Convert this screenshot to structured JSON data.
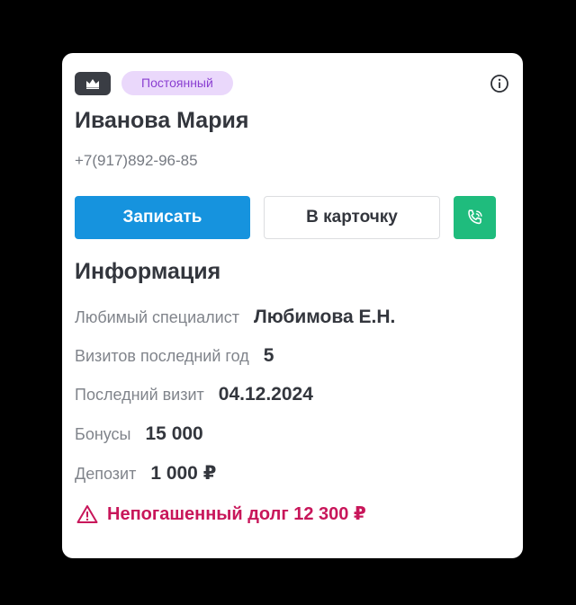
{
  "header": {
    "badge_icon": "crown-icon",
    "status_label": "Постоянный",
    "status_colors": {
      "background": "#ead8fb",
      "text": "#8a3fd1"
    },
    "info_icon": "info-icon"
  },
  "client": {
    "name": "Иванова Мария",
    "phone": "+7(917)892-96-85"
  },
  "actions": {
    "book_label": "Записать",
    "card_label": "В карточку",
    "call_icon": "phone-icon",
    "colors": {
      "book": "#1693de",
      "call": "#1fbc7d"
    }
  },
  "info": {
    "title": "Информация",
    "rows": [
      {
        "label": "Любимый специалист",
        "value": "Любимова Е.Н."
      },
      {
        "label": "Визитов последний год",
        "value": "5"
      },
      {
        "label": "Последний визит",
        "value": "04.12.2024"
      },
      {
        "label": "Бонусы",
        "value": "15 000"
      },
      {
        "label": "Депозит",
        "value": "1 000 ₽"
      }
    ]
  },
  "alert": {
    "icon": "warning-icon",
    "text": "Непогашенный долг 12 300 ₽",
    "color": "#c8165a"
  }
}
